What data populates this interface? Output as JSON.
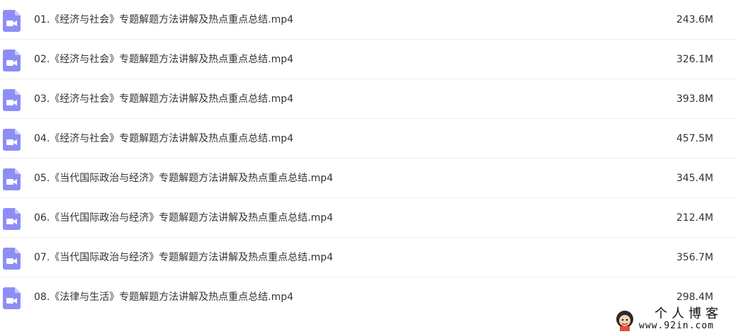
{
  "colors": {
    "icon_bg": "#8d8ef5",
    "icon_fold": "#c8c8ff",
    "icon_glyph": "#ffffff",
    "row_divider": "#eeeeee",
    "text": "#333333"
  },
  "files": [
    {
      "name": "01.《经济与社会》专题解题方法讲解及热点重点总结.mp4",
      "size": "243.6M",
      "icon": "video-file-icon"
    },
    {
      "name": "02.《经济与社会》专题解题方法讲解及热点重点总结.mp4",
      "size": "326.1M",
      "icon": "video-file-icon"
    },
    {
      "name": "03.《经济与社会》专题解题方法讲解及热点重点总结.mp4",
      "size": "393.8M",
      "icon": "video-file-icon"
    },
    {
      "name": "04.《经济与社会》专题解题方法讲解及热点重点总结.mp4",
      "size": "457.5M",
      "icon": "video-file-icon"
    },
    {
      "name": "05.《当代国际政治与经济》专题解题方法讲解及热点重点总结.mp4",
      "size": "345.4M",
      "icon": "video-file-icon"
    },
    {
      "name": "06.《当代国际政治与经济》专题解题方法讲解及热点重点总结.mp4",
      "size": "212.4M",
      "icon": "video-file-icon"
    },
    {
      "name": "07.《当代国际政治与经济》专题解题方法讲解及热点重点总结.mp4",
      "size": "356.7M",
      "icon": "video-file-icon"
    },
    {
      "name": "08.《法律与生活》专题解题方法讲解及热点重点总结.mp4",
      "size": "298.4M",
      "icon": "video-file-icon"
    }
  ],
  "watermark": {
    "title": "个人博客",
    "url": "www.92in.com"
  }
}
